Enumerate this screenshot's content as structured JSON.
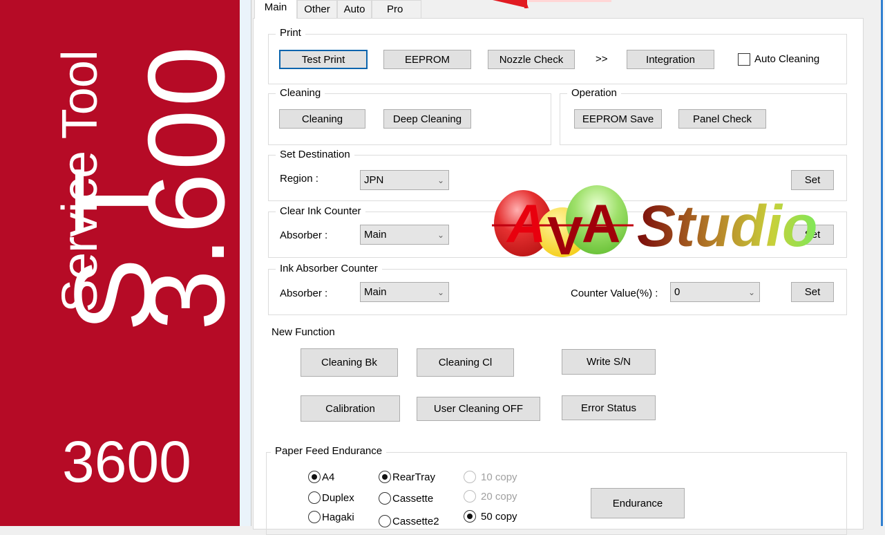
{
  "banner": {
    "service_tool": "Service Tool",
    "version": "3.600",
    "st_letters": [
      "S",
      "T"
    ],
    "model": "3600",
    "background_color": "#b60b26"
  },
  "tabs": [
    {
      "label": "Main",
      "active": true
    },
    {
      "label": "Other",
      "active": false
    },
    {
      "label": "Auto",
      "active": false
    },
    {
      "label": "Pro",
      "active": false
    }
  ],
  "print_group": {
    "title": "Print",
    "buttons": [
      "Test Print",
      "EEPROM",
      "Nozzle Check",
      "Integration"
    ],
    "separator": ">>",
    "auto_cleaning_label": "Auto Cleaning",
    "auto_cleaning_checked": false
  },
  "cleaning_group": {
    "title": "Cleaning",
    "buttons": [
      "Cleaning",
      "Deep Cleaning"
    ]
  },
  "operation_group": {
    "title": "Operation",
    "buttons": [
      "EEPROM Save",
      "Panel Check"
    ]
  },
  "set_destination": {
    "title": "Set Destination",
    "region_label": "Region :",
    "region_value": "JPN",
    "set_label": "Set"
  },
  "clear_ink_counter": {
    "title": "Clear Ink Counter",
    "absorber_label": "Absorber :",
    "absorber_value": "Main",
    "set_label": "Set"
  },
  "ink_absorber_counter": {
    "title": "Ink Absorber Counter",
    "absorber_label": "Absorber :",
    "absorber_value": "Main",
    "counter_label": "Counter Value(%) :",
    "counter_value": "0",
    "set_label": "Set"
  },
  "new_function": {
    "title": "New Function",
    "buttons": [
      "Cleaning Bk",
      "Cleaning Cl",
      "Write S/N",
      "Calibration",
      "User Cleaning OFF",
      "Error Status"
    ]
  },
  "paper_feed": {
    "title": "Paper Feed Endurance",
    "paper_sizes": [
      {
        "label": "A4",
        "selected": true
      },
      {
        "label": "Duplex",
        "selected": false
      },
      {
        "label": "Hagaki",
        "selected": false
      }
    ],
    "sources": [
      {
        "label": "RearTray",
        "selected": true
      },
      {
        "label": "Cassette",
        "selected": false
      },
      {
        "label": "Cassette2",
        "selected": false
      }
    ],
    "copies": [
      {
        "label": "10 copy",
        "selected": false,
        "disabled": true
      },
      {
        "label": "20 copy",
        "selected": false,
        "disabled": true
      },
      {
        "label": "50 copy",
        "selected": true,
        "disabled": false
      }
    ],
    "endurance_label": "Endurance"
  },
  "watermark": {
    "letters": [
      "A",
      "V",
      "A"
    ],
    "text": "Studio"
  }
}
